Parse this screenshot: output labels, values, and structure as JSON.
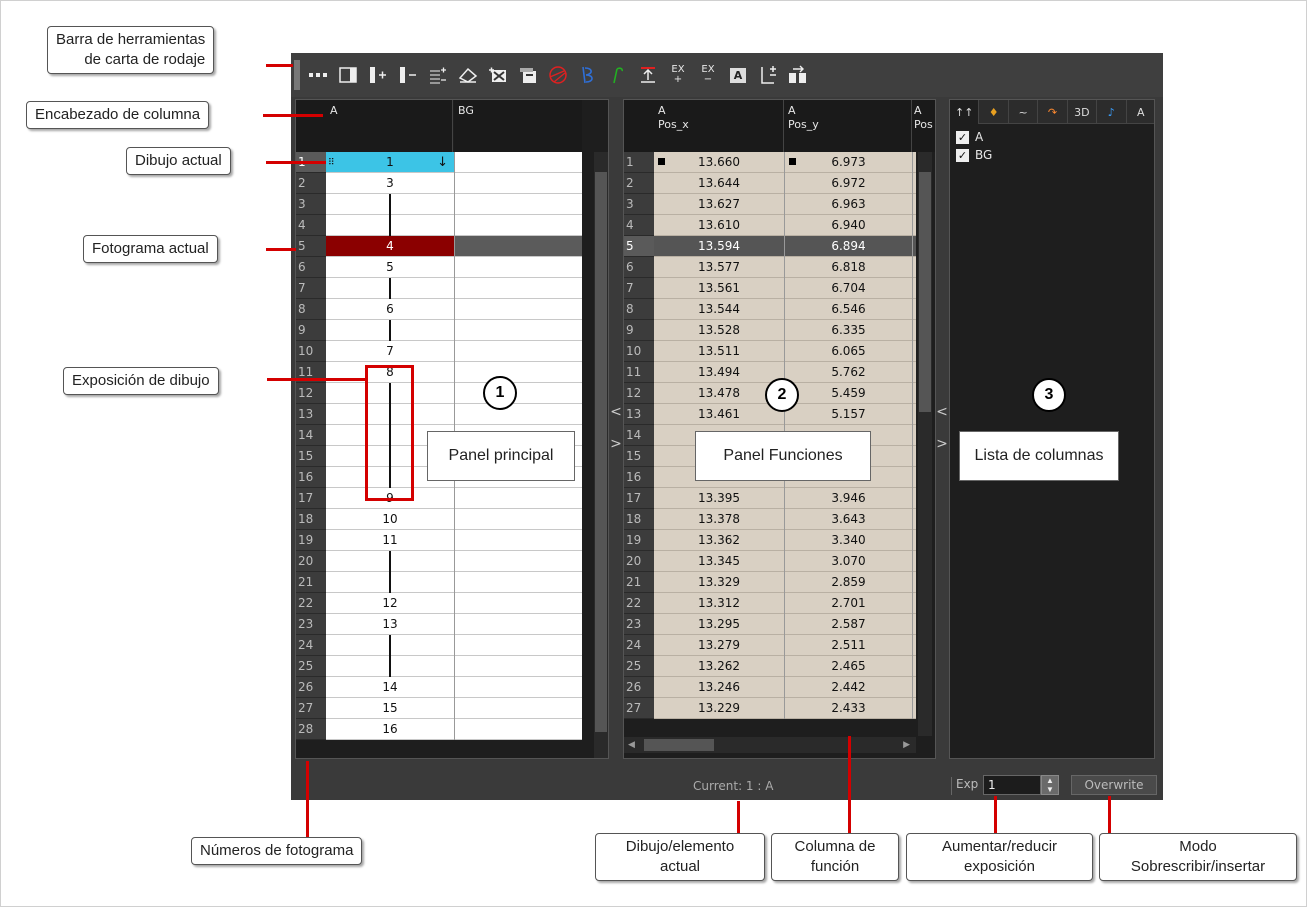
{
  "toolbar_icons": [
    "ellipsis-icon",
    "column-panel-icon",
    "add-column-icon",
    "remove-column-icon",
    "insert-frames-icon",
    "clear-icon",
    "add-drawing-icon",
    "duplicate-drawing-icon",
    "onion-skin-icon",
    "trace-icon",
    "smooth-icon",
    "extend-exposure-icon",
    "add-exposure-icon",
    "remove-exposure-icon",
    "text-column-icon",
    "increase-exposure-icon",
    "copy-drawing-icon"
  ],
  "toolbar_labels": {
    "add_ex": "EX\n+",
    "remove_ex": "EX\n−",
    "text_col": "A"
  },
  "main_panel": {
    "columns": [
      "A",
      "BG"
    ],
    "frame_numbers": [
      "1",
      "2",
      "3",
      "4",
      "5",
      "6",
      "7",
      "8",
      "9",
      "10",
      "11",
      "12",
      "13",
      "14",
      "15",
      "16",
      "17",
      "18",
      "19",
      "20",
      "21",
      "22",
      "23",
      "24",
      "25",
      "26",
      "27",
      "28"
    ],
    "cells": [
      "1",
      "3",
      "|",
      "|",
      "4",
      "5",
      "|",
      "6",
      "|",
      "7",
      "8",
      "|",
      "|",
      "|",
      "|",
      "|",
      "9",
      "10",
      "11",
      "|",
      "|",
      "12",
      "13",
      "|",
      "|",
      "14",
      "15",
      "16"
    ]
  },
  "function_panel": {
    "columns": [
      {
        "element": "A",
        "function": "Pos_x"
      },
      {
        "element": "A",
        "function": "Pos_y"
      },
      {
        "element": "A",
        "function": "Pos"
      }
    ],
    "frame_numbers": [
      "1",
      "2",
      "3",
      "4",
      "5",
      "6",
      "7",
      "8",
      "9",
      "10",
      "11",
      "12",
      "13",
      "14",
      "15",
      "16",
      "17",
      "18",
      "19",
      "20",
      "21",
      "22",
      "23",
      "24",
      "25",
      "26",
      "27"
    ],
    "pos_x": [
      "13.660",
      "13.644",
      "13.627",
      "13.610",
      "13.594",
      "13.577",
      "13.561",
      "13.544",
      "13.528",
      "13.511",
      "13.494",
      "13.478",
      "13.461",
      "",
      "",
      "13.411",
      "13.395",
      "13.378",
      "13.362",
      "13.345",
      "13.329",
      "13.312",
      "13.295",
      "13.279",
      "13.262",
      "13.246",
      "13.229"
    ],
    "pos_y": [
      "6.973",
      "6.972",
      "6.963",
      "6.940",
      "6.894",
      "6.818",
      "6.704",
      "6.546",
      "6.335",
      "6.065",
      "5.762",
      "5.459",
      "5.157",
      "",
      "",
      "4.248",
      "3.946",
      "3.643",
      "3.340",
      "3.070",
      "2.859",
      "2.701",
      "2.587",
      "2.511",
      "2.465",
      "2.442",
      "2.433"
    ]
  },
  "column_list": {
    "tabs": [
      "↑↑",
      "♦",
      "~",
      "↷",
      "3D",
      "♪",
      "A"
    ],
    "items": [
      {
        "label": "A",
        "checked": "✓"
      },
      {
        "label": "BG",
        "checked": "✓"
      }
    ]
  },
  "status_bar": {
    "current": "Current: 1 : A",
    "exp_label": "Exp",
    "exp_value": "1",
    "overwrite": "Overwrite"
  },
  "callouts": {
    "toolbar": "Barra de herramientas\nde carta de rodaje",
    "column_header": "Encabezado de columna",
    "current_drawing": "Dibujo actual",
    "current_frame": "Fotograma actual",
    "drawing_exposure": "Exposición de dibujo",
    "main_panel": "Panel principal",
    "function_panel": "Panel Funciones",
    "column_list": "Lista de columnas",
    "frame_numbers": "Números de fotograma",
    "drawing_element": "Dibujo/elemento\nactual",
    "function_column": "Columna de\nfunción",
    "exposure": "Aumentar/reducir\nexposición",
    "mode": "Modo\nSobrescribir/insertar"
  },
  "circles": [
    "1",
    "2",
    "3"
  ],
  "colors": {
    "current_drawing": "#3cc4e6",
    "current_frame": "#8b0000",
    "leader": "#d40000",
    "function_cells": "#d9d0c3"
  }
}
